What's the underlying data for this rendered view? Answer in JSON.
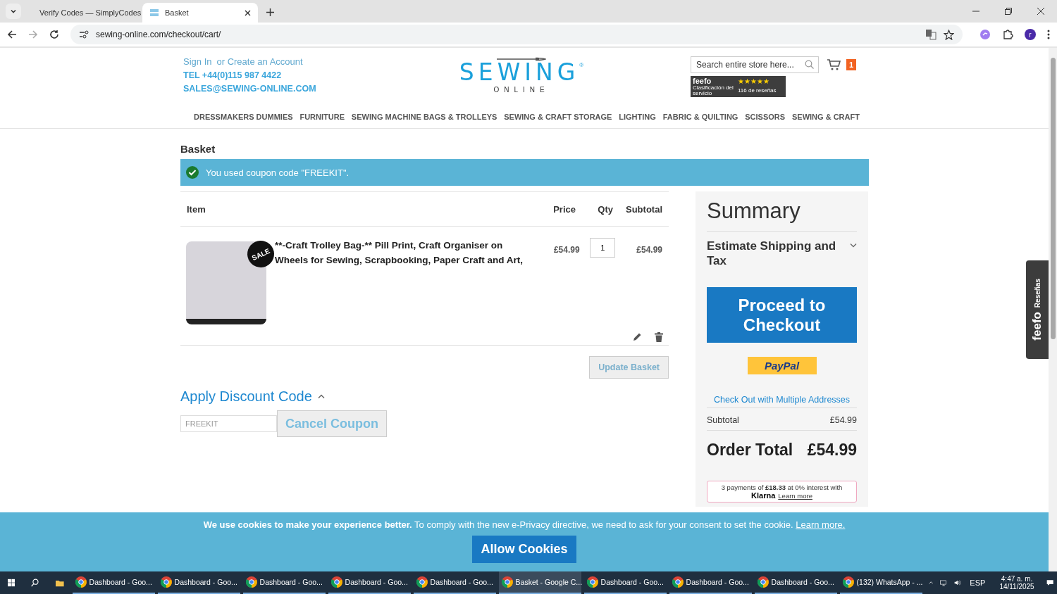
{
  "browser": {
    "tabs": [
      {
        "title": "Verify Codes — SimplyCodes",
        "selected": false
      },
      {
        "title": "Basket",
        "selected": true
      }
    ],
    "url": "sewing-online.com/checkout/cart/",
    "profile_initial": "r"
  },
  "header": {
    "sign_in": "Sign In",
    "create_account": "or Create an Account",
    "phone": "TEL +44(0)115 987 4422",
    "email": "SALES@SEWING-ONLINE.COM",
    "logo": "SEWING",
    "logo_mark": "®",
    "logo_sub": "ONLINE",
    "search_placeholder": "Search entire store here...",
    "cart_count": "1",
    "feefo": {
      "brand": "feefo",
      "rating_label": "Clasificación del servicio",
      "stars": 5,
      "reviews": "116 de reseñas"
    }
  },
  "nav": [
    "DRESSMAKERS DUMMIES",
    "FURNITURE",
    "SEWING MACHINE BAGS & TROLLEYS",
    "SEWING & CRAFT STORAGE",
    "LIGHTING",
    "FABRIC & QUILTING",
    "SCISSORS",
    "SEWING & CRAFT"
  ],
  "page_title": "Basket",
  "message": "You used coupon code \"FREEKIT\".",
  "cart": {
    "columns": [
      "Item",
      "Price",
      "Qty",
      "Subtotal"
    ],
    "items": [
      {
        "badge": "SALE",
        "name": "**-Craft Trolley Bag-** Pill Print, Craft Organiser on Wheels for Sewing, Scrapbooking, Paper Craft and Art,",
        "price": "£54.99",
        "qty": "1",
        "subtotal": "£54.99"
      }
    ],
    "update_button": "Update Basket"
  },
  "discount": {
    "title": "Apply Discount Code",
    "expanded": true,
    "value": "FREEKIT",
    "button": "Cancel Coupon"
  },
  "summary": {
    "title": "Summary",
    "shipping": "Estimate Shipping and Tax",
    "shipping_expanded": false,
    "checkout_button": "Proceed to Checkout",
    "paypal": "PayPal",
    "multi_address": "Check Out with Multiple Addresses",
    "subtotal_label": "Subtotal",
    "subtotal": "£54.99",
    "total_label": "Order Total",
    "total": "£54.99",
    "klarna_text": "3 payments of **£18.33** at 0% interest with",
    "klarna_brand": "Klarna",
    "klarna_link": "Learn more"
  },
  "cookie_bar": {
    "text": "**We use cookies to make your experience better.** To comply with the new e-Privacy directive, we need to ask for your consent to set the cookie.",
    "link": "Learn more.",
    "button": "Allow Cookies"
  },
  "feefo_tab": {
    "brand": "feefo",
    "label": "Reseñas"
  },
  "taskbar": {
    "apps": [
      {
        "title": "Dashboard - Goo...",
        "selected": false
      },
      {
        "title": "Dashboard - Goo...",
        "selected": false
      },
      {
        "title": "Dashboard - Goo...",
        "selected": false
      },
      {
        "title": "Dashboard - Goo...",
        "selected": false
      },
      {
        "title": "Dashboard - Goo...",
        "selected": false
      },
      {
        "title": "Basket - Google C...",
        "selected": true
      },
      {
        "title": "Dashboard - Goo...",
        "selected": false
      },
      {
        "title": "Dashboard - Goo...",
        "selected": false
      },
      {
        "title": "Dashboard - Goo...",
        "selected": false
      },
      {
        "title": "(132) WhatsApp - ...",
        "selected": false
      }
    ],
    "language": "ESP",
    "time": "4:47 a. m.",
    "date": "14/11/2025"
  }
}
